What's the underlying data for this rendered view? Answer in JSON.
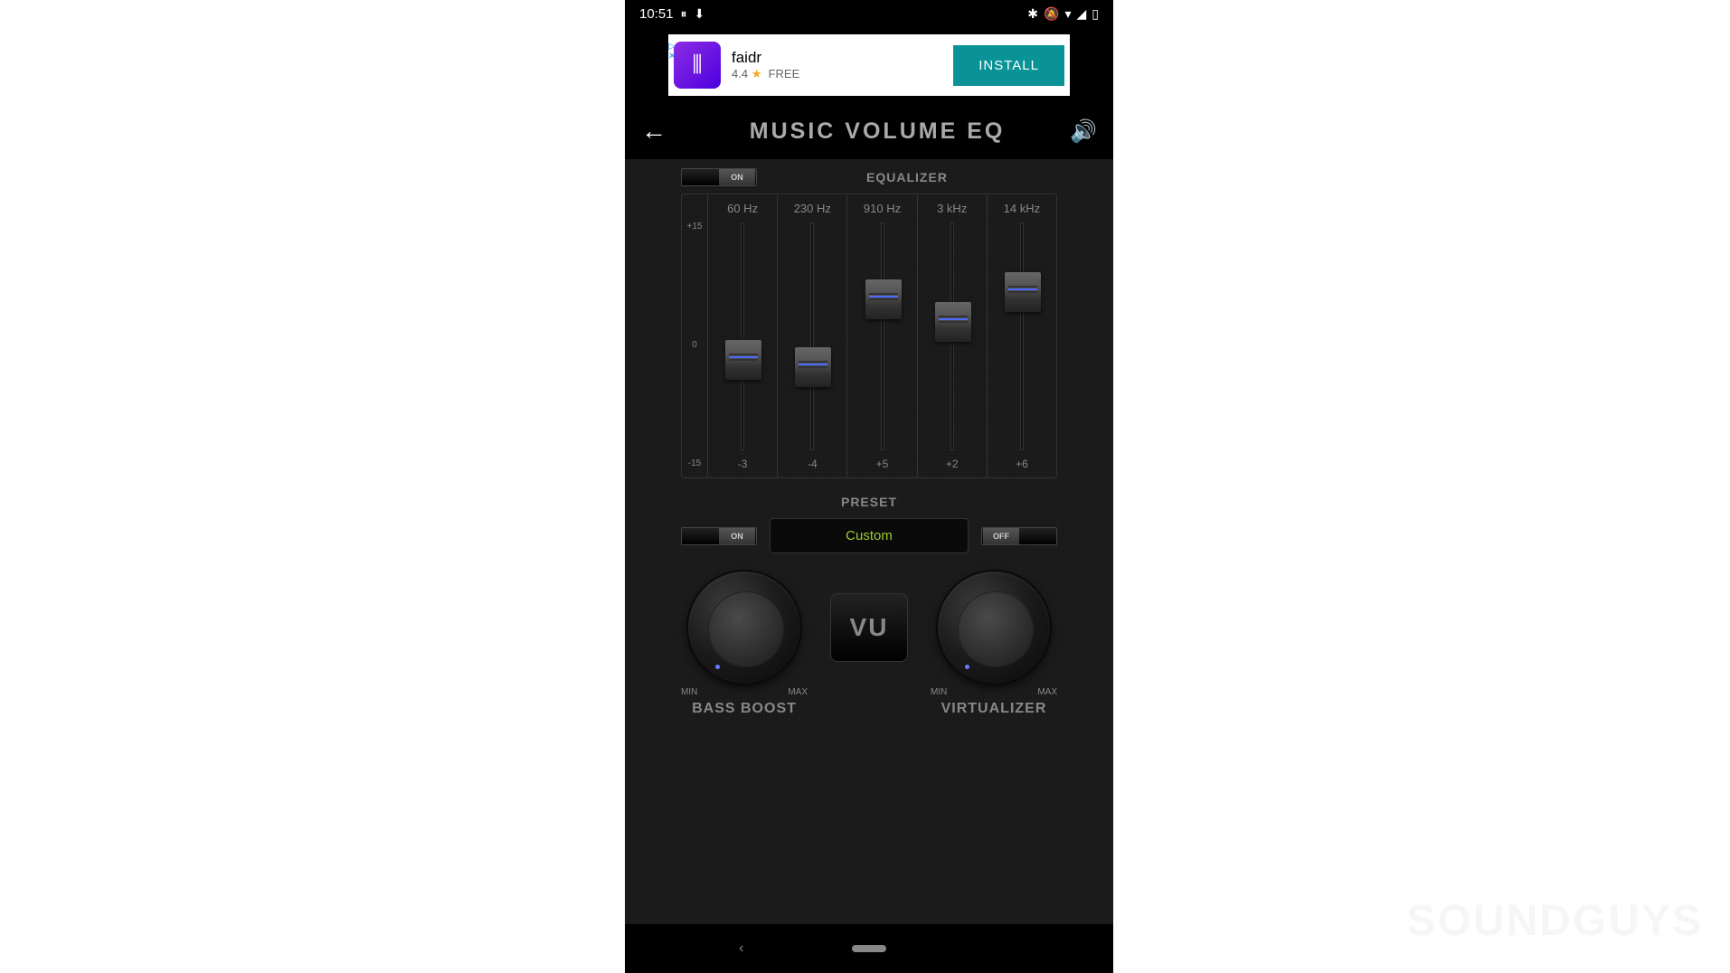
{
  "status_bar": {
    "time": "10:51",
    "icons": [
      "bluetooth",
      "alarm-off",
      "wifi",
      "signal",
      "battery"
    ]
  },
  "ad": {
    "title": "faidr",
    "rating": "4.4",
    "star": "★",
    "free": "FREE",
    "install": "INSTALL"
  },
  "header": {
    "title": "MUSIC VOLUME EQ"
  },
  "equalizer": {
    "title": "EQUALIZER",
    "toggle": "ON",
    "scale": {
      "max": "+15",
      "mid": "0",
      "min": "-15"
    },
    "bands": [
      {
        "freq": "60 Hz",
        "value": "-3",
        "pos": -3
      },
      {
        "freq": "230 Hz",
        "value": "-4",
        "pos": -4
      },
      {
        "freq": "910 Hz",
        "value": "+5",
        "pos": 5
      },
      {
        "freq": "3 kHz",
        "value": "+2",
        "pos": 2
      },
      {
        "freq": "14 kHz",
        "value": "+6",
        "pos": 6
      }
    ]
  },
  "preset": {
    "title": "PRESET",
    "left_toggle": "ON",
    "name": "Custom",
    "right_toggle": "OFF"
  },
  "knobs": {
    "bass": {
      "title": "BASS BOOST",
      "min": "MIN",
      "max": "MAX"
    },
    "vu": "VU",
    "virt": {
      "title": "VIRTUALIZER",
      "min": "MIN",
      "max": "MAX"
    }
  },
  "watermark": "SOUNDGUYS"
}
